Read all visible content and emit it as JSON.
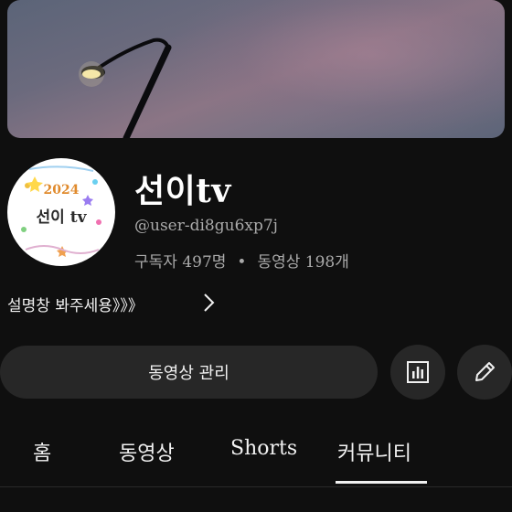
{
  "channel": {
    "name": "선이tv",
    "handle": "@user-di8gu6xp7j",
    "subscribers": "구독자 497명",
    "separator": "•",
    "videos": "동영상 198개",
    "description": "설명창 봐주세용》》》"
  },
  "avatar": {
    "year_text": "2024",
    "text": "선이 tv"
  },
  "actions": {
    "manage_label": "동영상 관리",
    "analytics_icon": "bar-chart-icon",
    "edit_icon": "pencil-icon"
  },
  "tabs": [
    {
      "label": "홈"
    },
    {
      "label": "동영상"
    },
    {
      "label": "Shorts"
    },
    {
      "label": "커뮤니티",
      "selected": true
    }
  ],
  "colors": {
    "background": "#0f0f0f",
    "button": "#272727",
    "secondary_text": "#aaaaaa"
  }
}
